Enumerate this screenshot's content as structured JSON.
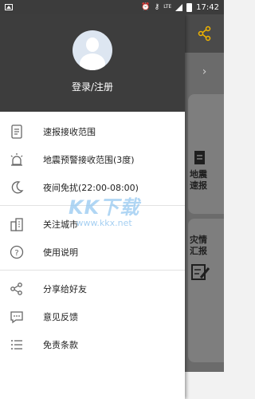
{
  "status_bar": {
    "time": "17:42",
    "network": "LTE",
    "icons": [
      "image-notification-icon",
      "alarm-icon",
      "key-icon",
      "signal-icon",
      "battery-icon"
    ]
  },
  "drawer": {
    "login_label": "登录/注册",
    "menu_groups": [
      [
        {
          "label": "速报接收范围",
          "icon": "document-icon"
        },
        {
          "label": "地震预警接收范围(3度)",
          "icon": "alarm-light-icon"
        },
        {
          "label": "夜间免扰(22:00-08:00)",
          "icon": "moon-icon"
        }
      ],
      [
        {
          "label": "关注城市",
          "icon": "city-icon"
        },
        {
          "label": "使用说明",
          "icon": "help-icon"
        }
      ],
      [
        {
          "label": "分享给好友",
          "icon": "share-icon"
        },
        {
          "label": "意见反馈",
          "icon": "feedback-icon"
        },
        {
          "label": "免责条款",
          "icon": "list-icon"
        }
      ]
    ]
  },
  "background_app": {
    "card_1_label": "地震\n速报",
    "card_2_label": "灾情\n汇报"
  },
  "watermark": {
    "text": "KK下载",
    "url": "www.kkx.net"
  },
  "colors": {
    "header_bg": "#3d3d3d",
    "status_bg": "#3c3c3c",
    "accent": "#f0b400"
  }
}
